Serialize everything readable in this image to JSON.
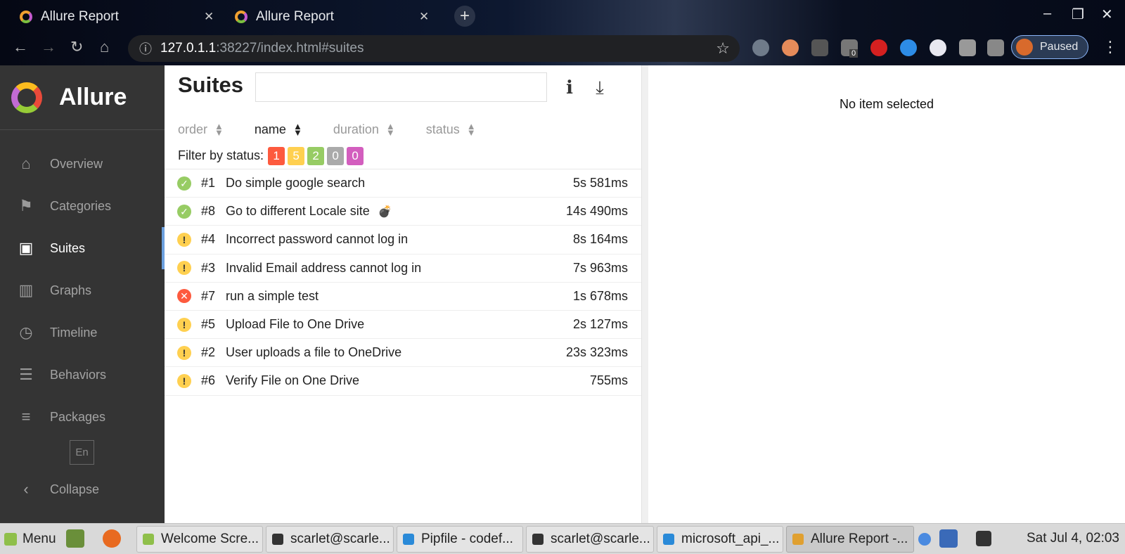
{
  "browser": {
    "tabs": [
      {
        "title": "Allure Report"
      },
      {
        "title": "Allure Report"
      }
    ],
    "new_tab": "+",
    "address": {
      "host": "127.0.1.1",
      "path": ":38227/index.html#suites"
    },
    "profile_label": "Paused",
    "extension_badge": "0"
  },
  "sidebar": {
    "brand": "Allure",
    "items": [
      {
        "label": "Overview",
        "icon": "home-icon",
        "glyph": "⌂"
      },
      {
        "label": "Categories",
        "icon": "flag-icon",
        "glyph": "⚑"
      },
      {
        "label": "Suites",
        "icon": "briefcase-icon",
        "glyph": "▣",
        "active": true
      },
      {
        "label": "Graphs",
        "icon": "bar-chart-icon",
        "glyph": "▥"
      },
      {
        "label": "Timeline",
        "icon": "clock-icon",
        "glyph": "◷"
      },
      {
        "label": "Behaviors",
        "icon": "list-icon",
        "glyph": "☰"
      },
      {
        "label": "Packages",
        "icon": "align-left-icon",
        "glyph": "≡"
      }
    ],
    "language": "En",
    "collapse_label": "Collapse"
  },
  "main": {
    "title": "Suites",
    "search_value": "",
    "sort": [
      {
        "label": "order"
      },
      {
        "label": "name",
        "active": true
      },
      {
        "label": "duration"
      },
      {
        "label": "status"
      }
    ],
    "filter_label": "Filter by status:",
    "filters": [
      {
        "count": "1",
        "color": "#fd5a3e",
        "status": "failed"
      },
      {
        "count": "5",
        "color": "#ffd050",
        "status": "broken"
      },
      {
        "count": "2",
        "color": "#97cc64",
        "status": "passed"
      },
      {
        "count": "0",
        "color": "#aaaaaa",
        "status": "skipped"
      },
      {
        "count": "0",
        "color": "#d35ebe",
        "status": "unknown"
      }
    ],
    "tests": [
      {
        "num": "#1",
        "title": "Do simple google search",
        "duration": "5s 581ms",
        "status": "passed"
      },
      {
        "num": "#8",
        "title": "Go to different Locale site",
        "duration": "14s 490ms",
        "status": "passed",
        "flaky": true
      },
      {
        "num": "#4",
        "title": "Incorrect password cannot log in",
        "duration": "8s 164ms",
        "status": "broken"
      },
      {
        "num": "#3",
        "title": "Invalid Email address cannot log in",
        "duration": "7s 963ms",
        "status": "broken"
      },
      {
        "num": "#7",
        "title": "run a simple test",
        "duration": "1s 678ms",
        "status": "failed"
      },
      {
        "num": "#5",
        "title": "Upload File to One Drive",
        "duration": "2s 127ms",
        "status": "broken"
      },
      {
        "num": "#2",
        "title": "User uploads a file to OneDrive",
        "duration": "23s 323ms",
        "status": "broken"
      },
      {
        "num": "#6",
        "title": "Verify File on One Drive",
        "duration": "755ms",
        "status": "broken"
      }
    ],
    "status_colors": {
      "passed": "#97cc64",
      "broken": "#ffd050",
      "failed": "#fd5a3e"
    }
  },
  "detail": {
    "empty_text": "No item selected"
  },
  "taskbar": {
    "menu_label": "Menu",
    "windows": [
      {
        "label": "Welcome Scre...",
        "color": "#8fbf4a"
      },
      {
        "label": "scarlet@scarle...",
        "color": "#333333"
      },
      {
        "label": "Pipfile - codef...",
        "color": "#2a8ad8"
      },
      {
        "label": "scarlet@scarle...",
        "color": "#333333"
      },
      {
        "label": "microsoft_api_...",
        "color": "#2a8ad8"
      },
      {
        "label": "Allure Report -...",
        "color": "#e0a030",
        "active": true
      }
    ],
    "clock": "Sat Jul  4, 02:03"
  }
}
